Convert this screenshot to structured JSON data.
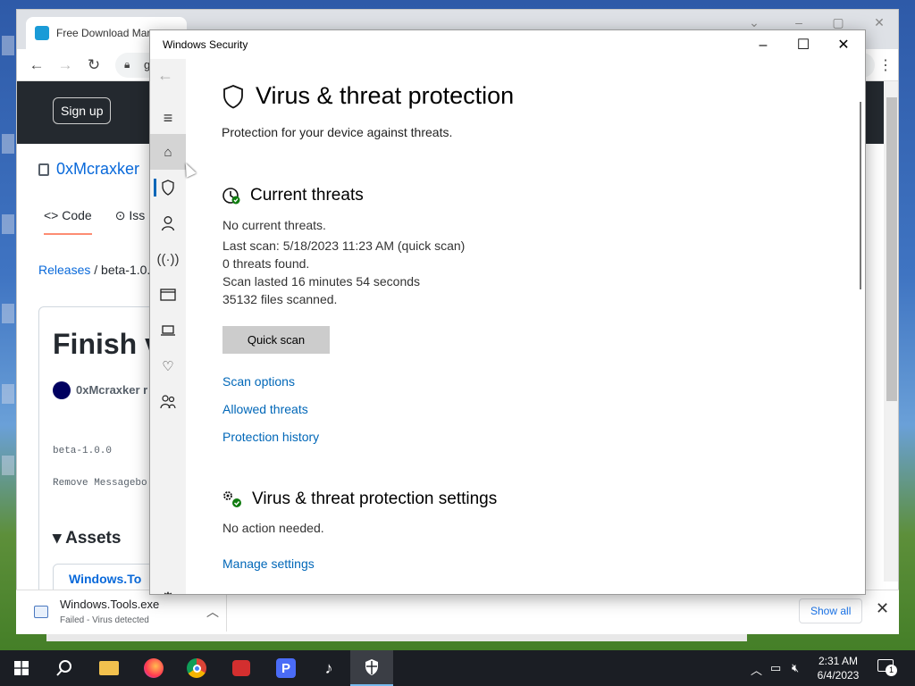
{
  "browser": {
    "tab1_title": "Free Download Mar",
    "url_fragment": "g",
    "signup_label": "Sign up",
    "repo_name": "0xMcraxker",
    "tabs": [
      "Code",
      "Iss"
    ],
    "crumb_releases": "Releases",
    "crumb_tag": "beta-1.0.0",
    "release_title": "Finish v",
    "author": "0xMcraxker r",
    "tag": "beta-1.0.0",
    "description": "Remove Messagebo",
    "assets_label": "Assets",
    "asset_name": "Windows.To"
  },
  "download": {
    "filename": "Windows.Tools.exe",
    "status": "Failed - Virus detected",
    "show_all": "Show all"
  },
  "security": {
    "window_title": "Windows Security",
    "page_title": "Virus & threat protection",
    "subtitle": "Protection for your device against threats.",
    "current_threats": {
      "heading": "Current threats",
      "lines": [
        "No current threats.",
        "Last scan: 5/18/2023 11:23 AM (quick scan)",
        "0 threats found.",
        "Scan lasted 16 minutes 54 seconds",
        "35132 files scanned."
      ],
      "quick_scan_label": "Quick scan",
      "links": [
        "Scan options",
        "Allowed threats",
        "Protection history"
      ]
    },
    "settings": {
      "heading": "Virus & threat protection settings",
      "status": "No action needed.",
      "link": "Manage settings"
    },
    "rail_icons": [
      "home-icon",
      "shield-icon",
      "person-icon",
      "wireless-icon",
      "app-browser-icon",
      "device-icon",
      "health-icon",
      "family-icon",
      "gear-icon"
    ]
  },
  "taskbar": {
    "time": "2:31 AM",
    "date": "6/4/2023",
    "notification_count": "1"
  }
}
